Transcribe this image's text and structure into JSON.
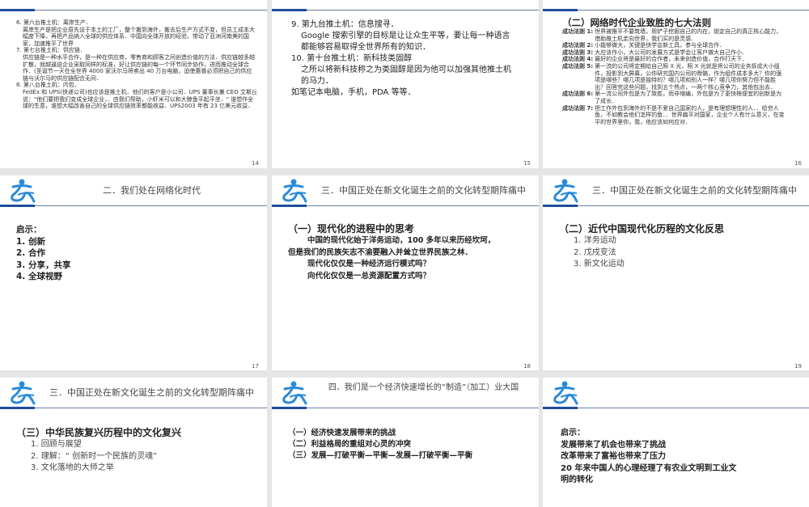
{
  "slides": [
    {
      "page": "14",
      "lines": [
        "6. 第六台推土机：离岸生产．",
        "离岸生产是把企业原先设于本土的工厂，整个搬到海外，搬去后生产方式不变，但员工成本大幅度下降，再把产品纳入全球的供应体系．中国向全球开放的经验，带动了亚洲河南美的国家，加速推平了世界",
        "7. 第七台推土机：供应链．",
        "供应链是一种水平合作，是一种在供应商，零售商和顾客之间创造价值的方法．供应链越多越扩散，就越逼迫企业采取同样的标准，好让供应链的每一个环节同步协作，进而推动全球合作．(圣诞节一天在全世界 4000 家沃尔马将卖出 40 万台电脑，迫使惠普必须把自己的供应链与沃尔马的供应链配合无间．",
        "8. 第八台推土机：内包．",
        "FedEx 和 UPS(快递公司)也应该是推土机．他们的客户是小公司．UPS 董事长兼 CEO 艾斯丘说：\"他们要把我们变成全球企业，．由我们帮助，小虾米可以和大鲸鱼平起平坐．\" 谁想作全球的生意，谁想大幅改善自己的全球供应链效率都能收益．UPS2003 年有 23 亿美元收益．"
      ]
    },
    {
      "page": "15",
      "lines": [
        "9. 第九台推土机：信息搜寻．",
        "Google 搜索引擎的目标是让让众生平等，要让每一种语言都能够容易取得全世界所有的知识．",
        "10. 第十台推土机：新科技类固醇",
        "之所以将新科技称之为类固醇是因为他可以加强其他推土机的马力．",
        "如笔记本电脑，手机，PDA 等等．"
      ]
    },
    {
      "page": "16",
      "heading": "（二）网络时代企业致胜的七大法则",
      "laws": [
        {
          "label": "成功法则 1:",
          "text": "世界被推平不要筑墙，用铲子挖掘自己的内在，锁定自己的真正核心能力，借助推土机走向世界，我们买的是灵感．"
        },
        {
          "label": "成功法则 2:",
          "text": "小能够做大，关键是快学会新工具，参与全球合作．"
        },
        {
          "label": "成功法则 3:",
          "text": "大应该作小，大公司的发展方式是学会让客户做大自己作小．"
        },
        {
          "label": "成功法则 4:",
          "text": "最好的企业将是最好的合作者，未来创造价值，合作打天下．"
        },
        {
          "label": "成功法则 5:",
          "text": "第一流的公司将定期给自己照 X 光，照 X 光就是将公司的业务拆成大小组件，投影到大屏幕，公你研究国内公司的骨骼，作为组件成本多大？你的强项是哪些？哪几项是独特的？哪几项和别人一样？哪几项你努力但不能胜出？回答完这些问题，找到五个热点，一两个核心竞争力，其他包出去．"
        },
        {
          "label": "成功法则 6:",
          "text": "第一流公司外包是为了致胜，而非缩编，外包是为了更快根便宜的创新是为了成长．"
        },
        {
          "label": "成功法则 7:",
          "text": "把工作外包到海外的不是不爱自己国家的人，是有理想理性的人．．给穷人鱼，不如教会他们怎样钓鱼．．世界扁平对国家，企业个人有什么意义，在变平的世界里你，我，他应该如何应对．"
        }
      ]
    },
    {
      "page": "17",
      "title": "二．我们处在网络化时代",
      "heading": "启示：",
      "items": [
        "1. 创新",
        "2. 合作",
        "3. 分享，共享",
        "4. 全球视野"
      ]
    },
    {
      "page": "18",
      "title": "三．中国正处在新文化诞生之前的文化转型期阵痛中",
      "heading": "（一）现代化的进程中的思考",
      "paras": [
        "中国的现代化始于洋务运动，100 多年以来历经坎坷，但是我们的民族矢志不渝要融入并耸立世界民族之林．",
        "现代化仅仅是一种经济运行模式吗？",
        "向代化仅仅是一总资源配置方式吗？"
      ]
    },
    {
      "page": "19",
      "title": "三．中国正处在新文化诞生之前的文化转型期阵痛中",
      "heading": "（二）近代中国现代化历程的文化反思",
      "items": [
        "1. 洋务运动",
        "2. 戊戌变法",
        "3. 新文化运动"
      ]
    },
    {
      "title": "三．中国正处在新文化诞生之前的文化转型期阵痛中",
      "heading": "（三）中华民族复兴历程中的文化复兴",
      "items": [
        "1. 回顾与展望",
        "2. 理解：“ 创新时一个民族的灵魂”",
        "3. 文化落地的大师之举"
      ]
    },
    {
      "title": "四．我们是一个经济快速增长的“制造”（加工）业大国",
      "items": [
        "（一）经济快速发展带来的挑战",
        "（二）利益格局的重组对心灵的冲突",
        "（三）发展—打破平衡—平衡—发展—打破平衡—平衡"
      ]
    },
    {
      "items": [
        "启示：",
        "发展带来了机会也带来了挑战",
        "改革带来了富裕也带来了压力",
        "20 年来中国人的心理经理了有农业文明到工业文明的转化"
      ]
    }
  ],
  "colors": {
    "accent": "#1f4e9a",
    "logo": "#2a8ad8"
  }
}
